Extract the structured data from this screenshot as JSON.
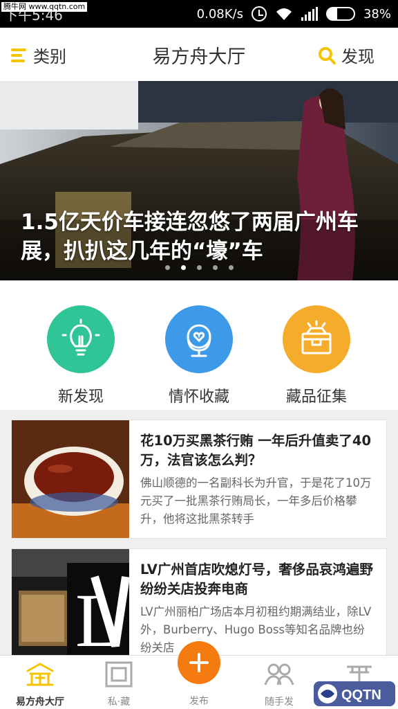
{
  "status_bar": {
    "watermark": "腾牛网 www.qqtn.com",
    "time": "下午5:46",
    "net_speed": "0.08K/s",
    "battery": "38%",
    "battery_level": 0.38
  },
  "header": {
    "left_label": "类别",
    "title": "易方舟大厅",
    "right_label": "发现",
    "accent_color": "#f5c400"
  },
  "banner": {
    "caption": "1.5亿天价车接连忽悠了两届广州车展，扒扒这几年的“壕”车",
    "dots": 5,
    "active_dot": 1
  },
  "categories": [
    {
      "label": "新发现",
      "icon": "lightbulb-icon",
      "color": "#2fc596"
    },
    {
      "label": "情怀收藏",
      "icon": "globe-heart-icon",
      "color": "#3c9ae8"
    },
    {
      "label": "藏品征集",
      "icon": "treasure-box-icon",
      "color": "#f5ac2b"
    }
  ],
  "articles": [
    {
      "title": "花10万买黑茶行贿 一年后升值卖了40万，法官该怎么判？",
      "desc": "佛山顺德的一名副科长为升官，于是花了10万元买了一批黑茶行贿局长，一年多后价格攀升，他将这批黑茶转手",
      "thumb": "tea-cup-image"
    },
    {
      "title": "LV广州首店吹熄灯号，奢侈品哀鸿遍野纷纷关店投奔电商",
      "desc": "LV广州丽柏广场店本月初租约期满结业，除LV外，Burberry、Hugo Boss等知名品牌也纷纷关店",
      "thumb": "lv-store-image"
    }
  ],
  "tabs": [
    {
      "label": "易方舟大厅",
      "icon": "ark-hall-icon"
    },
    {
      "label": "私·藏",
      "icon": "private-collection-icon"
    },
    {
      "label": "发布",
      "icon": "plus-icon"
    },
    {
      "label": "随手发",
      "icon": "people-icon"
    },
    {
      "label": "",
      "icon": "pavilion-icon"
    }
  ],
  "corner_mark": "QQTN"
}
